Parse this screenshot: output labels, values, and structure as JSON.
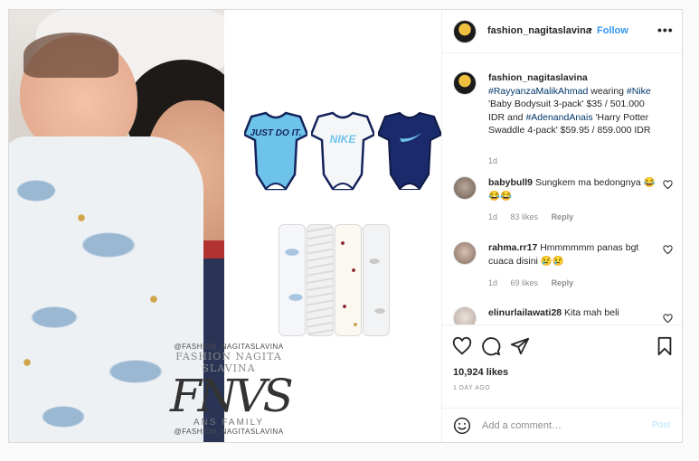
{
  "post": {
    "author": "fashion_nagitaslavina",
    "separator": "•",
    "follow_label": "Follow",
    "more_label": "•••"
  },
  "caption": {
    "username": "fashion_nagitaslavina",
    "tag_1": "#RayyanzaMalikAhmad",
    "text_1": " wearing ",
    "tag_2": "#Nike",
    "text_2": " 'Baby Bodysuit 3-pack' $35 / 501.000 IDR and ",
    "tag_3": "#AdenandAnais",
    "text_3": " 'Harry Potter Swaddle 4-pack' $59.95 / 859.000 IDR",
    "time": "1d"
  },
  "comments": [
    {
      "username": "babybull9",
      "text": "Sungkem ma bedongnya 😂😂😂",
      "time": "1d",
      "likes": "83 likes",
      "reply": "Reply"
    },
    {
      "username": "rahma.rr17",
      "text": "Hmmmmmm panas bgt cuaca disini 😢😢",
      "time": "1d",
      "likes": "69 likes",
      "reply": "Reply"
    },
    {
      "username": "elinurlailawati28",
      "text": "Kita mah beli"
    }
  ],
  "actions": {
    "likes": "10,924 likes",
    "date": "1 DAY AGO"
  },
  "add_comment": {
    "placeholder": "Add a comment…",
    "post_label": "Post"
  },
  "media": {
    "watermark": {
      "handle_top": "@FASHION_NAGITASLAVINA",
      "name": "FASHION NAGITA SLAVINA",
      "logo": "FNVS",
      "family": "ANS FAMILY",
      "handle_bottom": "@FASHION_NAGITASLAVINA"
    },
    "onesie_1_text": "JUST DO IT.",
    "onesie_2_text": "NIKE"
  },
  "colors": {
    "accent": "#3897f0",
    "tag": "#00376b",
    "muted": "#8e8e8e",
    "onesie_1": "#6ec3ea",
    "onesie_2": "#f4f6f8",
    "onesie_3": "#1b2a6b"
  },
  "icons": [
    "heart-icon",
    "comment-icon",
    "share-icon",
    "bookmark-icon",
    "emoji-icon",
    "more-icon"
  ]
}
